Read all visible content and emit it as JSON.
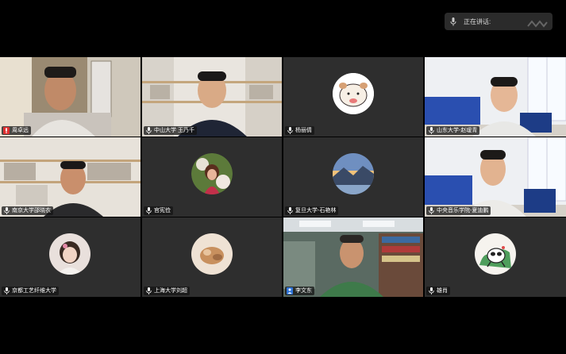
{
  "speaking_indicator": {
    "text": "正在讲话:",
    "icon": "microphone-icon"
  },
  "participants": [
    {
      "name": "周卓远",
      "mic": "muted-mic-icon"
    },
    {
      "name": "中山大学 王乃千",
      "mic": "mic-icon"
    },
    {
      "name": "杨丽倩",
      "mic": "mic-icon"
    },
    {
      "name": "山东大学-赵瑷青",
      "mic": "mic-icon"
    },
    {
      "name": "南京大学邵晓农",
      "mic": "mic-icon"
    },
    {
      "name": "官宪俭",
      "mic": "mic-icon"
    },
    {
      "name": "复旦大学-石艳林",
      "mic": "mic-icon"
    },
    {
      "name": "中央音乐学院-夏迪鹏",
      "mic": "mic-icon"
    },
    {
      "name": "京都工艺纤维大学",
      "mic": "mic-icon"
    },
    {
      "name": "上海大学刘超",
      "mic": "mic-icon"
    },
    {
      "name": "李文东",
      "mic": "person-icon"
    },
    {
      "name": "雄肖",
      "mic": "mic-icon"
    }
  ],
  "colors": {
    "muted": "#e03030",
    "person": "#2f74d8",
    "tile": "#303030"
  }
}
